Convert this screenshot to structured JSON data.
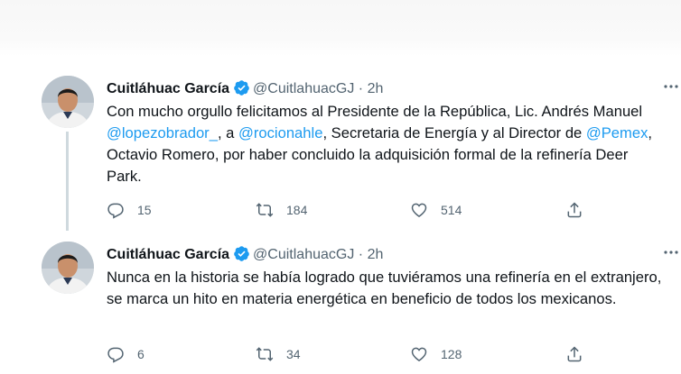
{
  "tweets": [
    {
      "author": "Cuitláhuac García",
      "handle": "@CuitlahuacGJ",
      "separator": "·",
      "time": "2h",
      "text_parts": [
        {
          "t": "Con mucho orgullo felicitamos al Presidente de la República, Lic. Andrés Manuel ",
          "mention": false
        },
        {
          "t": "@lopezobrador_",
          "mention": true
        },
        {
          "t": ", a ",
          "mention": false
        },
        {
          "t": "@rocionahle",
          "mention": true
        },
        {
          "t": ", Secretaria de Energía y al Director de ",
          "mention": false
        },
        {
          "t": "@Pemex",
          "mention": true
        },
        {
          "t": ", Octavio Romero, por haber concluido la adquisición formal de la refinería Deer Park.",
          "mention": false
        }
      ],
      "replies": "15",
      "retweets": "184",
      "likes": "514"
    },
    {
      "author": "Cuitláhuac García",
      "handle": "@CuitlahuacGJ",
      "separator": "·",
      "time": "2h",
      "text_parts": [
        {
          "t": "Nunca en la historia se había logrado que tuviéramos una refinería en el extranjero, se marca un hito en materia energética en beneficio de todos los mexicanos.",
          "mention": false
        }
      ],
      "replies": "6",
      "retweets": "34",
      "likes": "128"
    }
  ],
  "colors": {
    "accent": "#1d9bf0",
    "muted": "#536471",
    "text": "#0f1419",
    "thread_line": "#cfd9de"
  },
  "icons": [
    "verified-badge-icon",
    "more-options-icon",
    "reply-icon",
    "retweet-icon",
    "like-icon",
    "share-icon"
  ]
}
